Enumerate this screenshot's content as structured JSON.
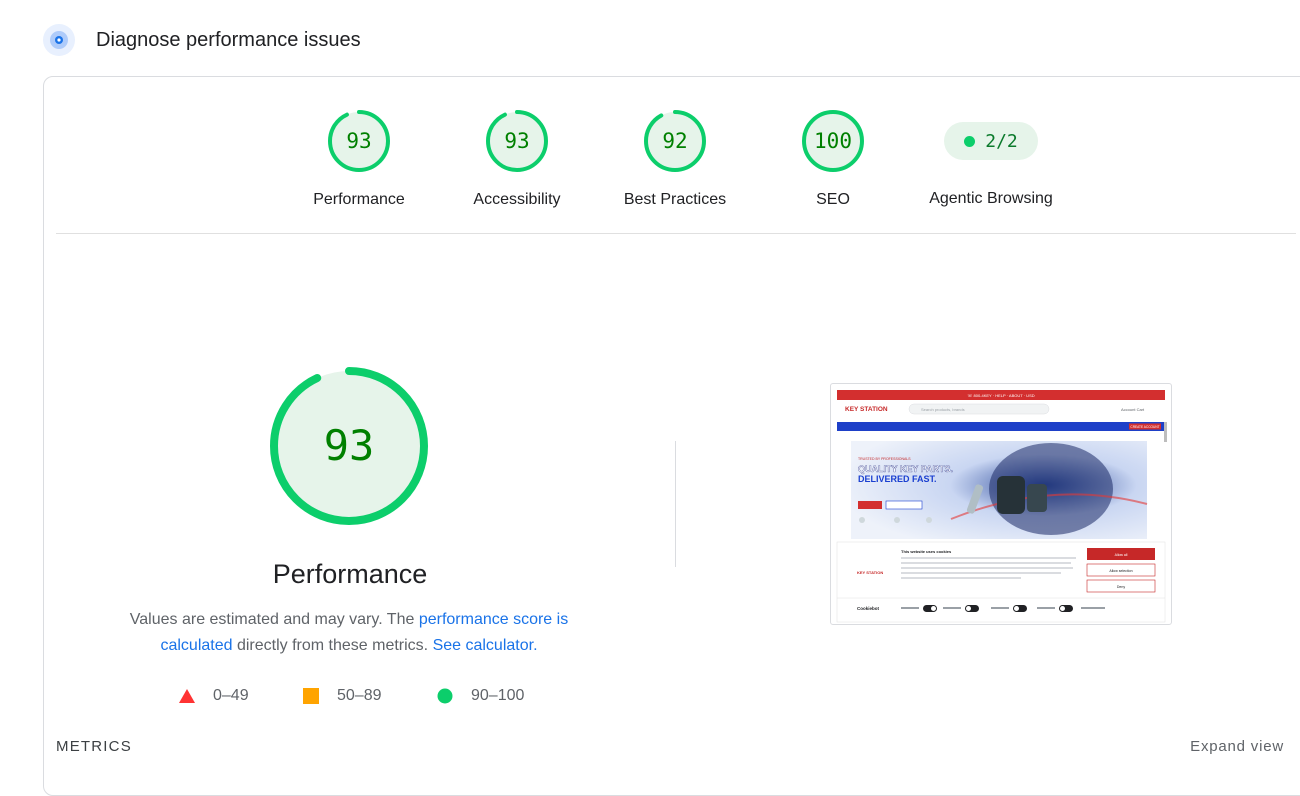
{
  "header": {
    "title": "Diagnose performance issues",
    "icon": "lighthouse-target-icon"
  },
  "categories": [
    {
      "score": "93",
      "label": "Performance",
      "value": 0.93
    },
    {
      "score": "93",
      "label": "Accessibility",
      "value": 0.93
    },
    {
      "score": "92",
      "label": "Best Practices",
      "value": 0.92
    },
    {
      "score": "100",
      "label": "SEO",
      "value": 1.0
    }
  ],
  "agentic": {
    "value": "2/2",
    "label": "Agentic Browsing"
  },
  "performance": {
    "score": "93",
    "value": 0.93,
    "title": "Performance",
    "desc_before": "Values are estimated and may vary. The ",
    "desc_link1": "performance score is calculated",
    "desc_middle": " directly from these metrics. ",
    "desc_link2": "See calculator."
  },
  "legend": [
    {
      "range": "0–49",
      "shape": "triangle",
      "color": "#ff3333"
    },
    {
      "range": "50–89",
      "shape": "square",
      "color": "#ffa400"
    },
    {
      "range": "90–100",
      "shape": "circle",
      "color": "#0cce6b"
    }
  ],
  "colors": {
    "pass": "#0cce6b",
    "pass_text": "#008000",
    "pass_fill": "#e6f4ea",
    "link": "#1a73e8"
  },
  "screenshot": {
    "topbar": "☏ 800-4KEY   ·   HELP   ·   ABOUT   ·   USD",
    "logo": "KEY STATION",
    "search_placeholder": "Search products, brands",
    "nav_right": "Account   Cart",
    "nav_cta": "CREATE ACCOUNT",
    "hero_kicker": "TRUSTED BY PROFESSIONALS",
    "hero_line1": "QUALITY KEY PARTS.",
    "hero_line2": "DELIVERED FAST.",
    "cookie_title": "This website uses cookies",
    "cookie_allow_all": "Allow all",
    "cookie_allow_selection": "Allow selection",
    "cookie_deny": "Deny",
    "cookie_brand": "Cookiebot"
  },
  "footer": {
    "metrics_label": "METRICS",
    "expand_label": "Expand view"
  }
}
